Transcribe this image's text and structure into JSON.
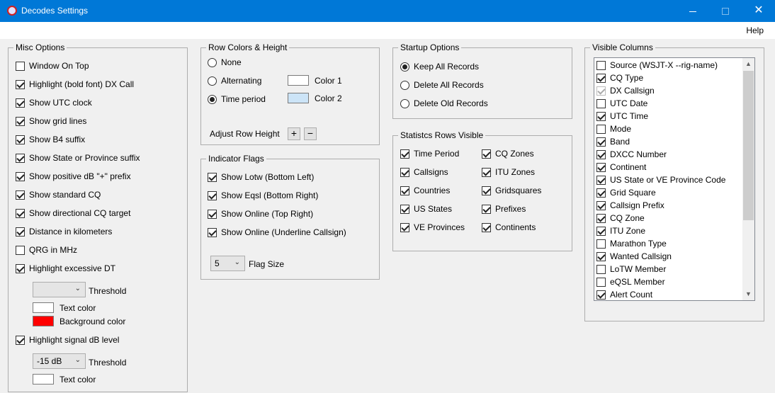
{
  "window": {
    "title": "Decodes Settings",
    "minimize_label": "",
    "close_label": "✕"
  },
  "menu": {
    "help": "Help"
  },
  "misc": {
    "title": "Misc Options",
    "items": [
      {
        "label": "Window On Top",
        "checked": false
      },
      {
        "label": "Highlight (bold font) DX Call",
        "checked": true
      },
      {
        "label": "Show UTC clock",
        "checked": true
      },
      {
        "label": "Show grid lines",
        "checked": true
      },
      {
        "label": "Show B4 suffix",
        "checked": true
      },
      {
        "label": "Show State or Province suffix",
        "checked": true
      },
      {
        "label": "Show positive dB \"+\" prefix",
        "checked": true
      },
      {
        "label": "Show standard CQ",
        "checked": true
      },
      {
        "label": "Show directional CQ target",
        "checked": true
      },
      {
        "label": "Distance in kilometers",
        "checked": true
      },
      {
        "label": "QRG in MHz",
        "checked": false
      },
      {
        "label": "Highlight excessive DT",
        "checked": true
      }
    ],
    "dt_threshold_value": "",
    "dt_threshold_label": "Threshold",
    "dt_text_color_label": "Text color",
    "dt_bg_color_label": "Background color",
    "dt_text_color": "#ffffff",
    "dt_bg_color": "#ff0000",
    "signal_item": {
      "label": "Highlight signal dB level",
      "checked": true
    },
    "signal_threshold_value": "-15 dB",
    "signal_threshold_label": "Threshold",
    "signal_text_color_label": "Text color",
    "signal_text_color": "#ffffff"
  },
  "row_colors": {
    "title": "Row Colors & Height",
    "options": [
      {
        "label": "None",
        "selected": false
      },
      {
        "label": "Alternating",
        "selected": false
      },
      {
        "label": "Time period",
        "selected": true
      }
    ],
    "color1_label": "Color 1",
    "color2_label": "Color 2",
    "color1": "#ffffff",
    "color2": "#cce4f7",
    "adjust_label": "Adjust Row Height",
    "plus": "+",
    "minus": "−"
  },
  "indicator": {
    "title": "Indicator Flags",
    "items": [
      {
        "label": "Show Lotw (Bottom Left)",
        "checked": true
      },
      {
        "label": "Show Eqsl (Bottom Right)",
        "checked": true
      },
      {
        "label": "Show Online (Top Right)",
        "checked": true
      },
      {
        "label": "Show Online (Underline Callsign)",
        "checked": true
      }
    ],
    "flag_size_value": "5",
    "flag_size_label": "Flag Size"
  },
  "startup": {
    "title": "Startup Options",
    "options": [
      {
        "label": "Keep All Records",
        "selected": true
      },
      {
        "label": "Delete All Records",
        "selected": false
      },
      {
        "label": "Delete Old Records",
        "selected": false
      }
    ]
  },
  "stats": {
    "title": "Statistcs Rows Visible",
    "col1": [
      {
        "label": "Time Period",
        "checked": true
      },
      {
        "label": "Callsigns",
        "checked": true
      },
      {
        "label": "Countries",
        "checked": true
      },
      {
        "label": "US States",
        "checked": true
      },
      {
        "label": "VE Provinces",
        "checked": true
      }
    ],
    "col2": [
      {
        "label": "CQ Zones",
        "checked": true
      },
      {
        "label": "ITU Zones",
        "checked": true
      },
      {
        "label": "Gridsquares",
        "checked": true
      },
      {
        "label": "Prefixes",
        "checked": true
      },
      {
        "label": "Continents",
        "checked": true
      }
    ]
  },
  "visible_columns": {
    "title": "Visible Columns",
    "items": [
      {
        "label": "Source (WSJT-X --rig-name)",
        "checked": false
      },
      {
        "label": "CQ Type",
        "checked": true
      },
      {
        "label": "DX Callsign",
        "checked": true,
        "disabled": true
      },
      {
        "label": "UTC Date",
        "checked": false
      },
      {
        "label": "UTC Time",
        "checked": true
      },
      {
        "label": "Mode",
        "checked": false
      },
      {
        "label": "Band",
        "checked": true
      },
      {
        "label": "DXCC Number",
        "checked": true
      },
      {
        "label": "Continent",
        "checked": true
      },
      {
        "label": "US State or VE Province Code",
        "checked": true
      },
      {
        "label": "Grid Square",
        "checked": true
      },
      {
        "label": "Callsign Prefix",
        "checked": true
      },
      {
        "label": "CQ Zone",
        "checked": true
      },
      {
        "label": "ITU Zone",
        "checked": true
      },
      {
        "label": "Marathon Type",
        "checked": false
      },
      {
        "label": "Wanted Callsign",
        "checked": true
      },
      {
        "label": "LoTW Member",
        "checked": false
      },
      {
        "label": "eQSL Member",
        "checked": false
      },
      {
        "label": "Alert Count",
        "checked": true
      }
    ]
  }
}
